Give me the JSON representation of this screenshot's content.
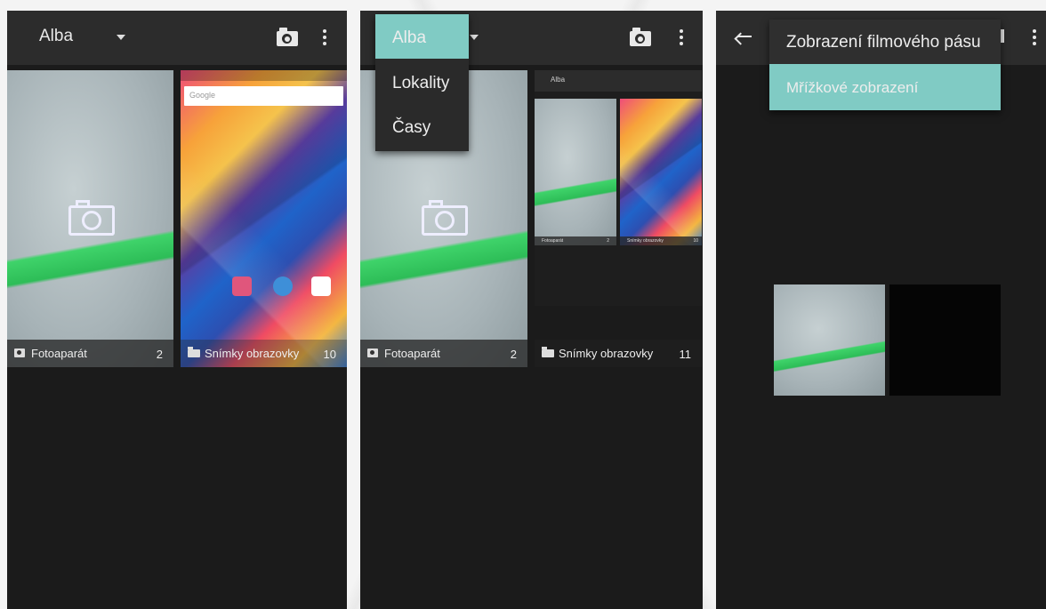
{
  "panels": [
    {
      "title": "Alba",
      "albums": [
        {
          "label": "Fotoaparát",
          "count": "2",
          "icon": "camera-icon"
        },
        {
          "label": "Snímky obrazovky",
          "count": "10",
          "icon": "folder-icon"
        }
      ]
    },
    {
      "title": "Alba",
      "menu": [
        {
          "label": "Alba",
          "selected": true
        },
        {
          "label": "Lokality",
          "selected": false
        },
        {
          "label": "Časy",
          "selected": false
        }
      ],
      "albums": [
        {
          "label": "Fotoaparát",
          "count": "2",
          "icon": "camera-icon"
        },
        {
          "label": "Snímky obrazovky",
          "count": "11",
          "icon": "folder-icon"
        }
      ],
      "mini_screenshot": {
        "title": "Alba",
        "caption_left": "Fotoaparát",
        "caption_left_count": "2",
        "caption_right": "Snímky obrazovky",
        "caption_right_count": "10"
      }
    },
    {
      "menu": [
        {
          "label": "Zobrazení filmového pásu",
          "selected": false
        },
        {
          "label": "Mřížkové zobrazení",
          "selected": true
        }
      ]
    }
  ],
  "mini_search": "Google",
  "colors": {
    "accent": "#80cbc4",
    "background": "#1b1b1b",
    "appbar": "#2c2c2c"
  }
}
